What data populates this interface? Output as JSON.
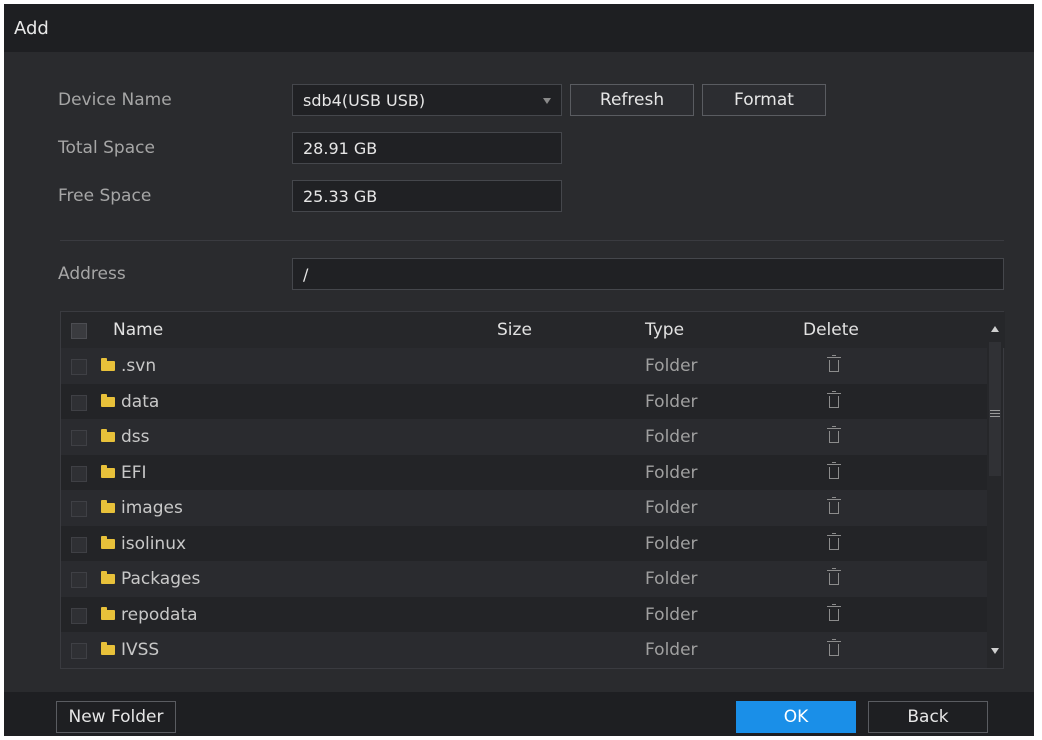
{
  "dialog": {
    "title": "Add"
  },
  "form": {
    "device_name_label": "Device Name",
    "device_name_value": "sdb4(USB USB)",
    "refresh_label": "Refresh",
    "format_label": "Format",
    "total_space_label": "Total Space",
    "total_space_value": "28.91 GB",
    "free_space_label": "Free Space",
    "free_space_value": "25.33 GB",
    "address_label": "Address",
    "address_value": "/"
  },
  "table": {
    "columns": [
      "Name",
      "Size",
      "Type",
      "Delete"
    ],
    "rows": [
      {
        "name": ".svn",
        "size": "",
        "type": "Folder"
      },
      {
        "name": "data",
        "size": "",
        "type": "Folder"
      },
      {
        "name": "dss",
        "size": "",
        "type": "Folder"
      },
      {
        "name": "EFI",
        "size": "",
        "type": "Folder"
      },
      {
        "name": "images",
        "size": "",
        "type": "Folder"
      },
      {
        "name": "isolinux",
        "size": "",
        "type": "Folder"
      },
      {
        "name": "Packages",
        "size": "",
        "type": "Folder"
      },
      {
        "name": "repodata",
        "size": "",
        "type": "Folder"
      },
      {
        "name": "IVSS",
        "size": "",
        "type": "Folder"
      }
    ]
  },
  "footer": {
    "new_folder_label": "New Folder",
    "ok_label": "OK",
    "back_label": "Back"
  },
  "colors": {
    "accent": "#1a8fe8",
    "folder": "#e8c13a",
    "background": "#2a2b2e"
  }
}
